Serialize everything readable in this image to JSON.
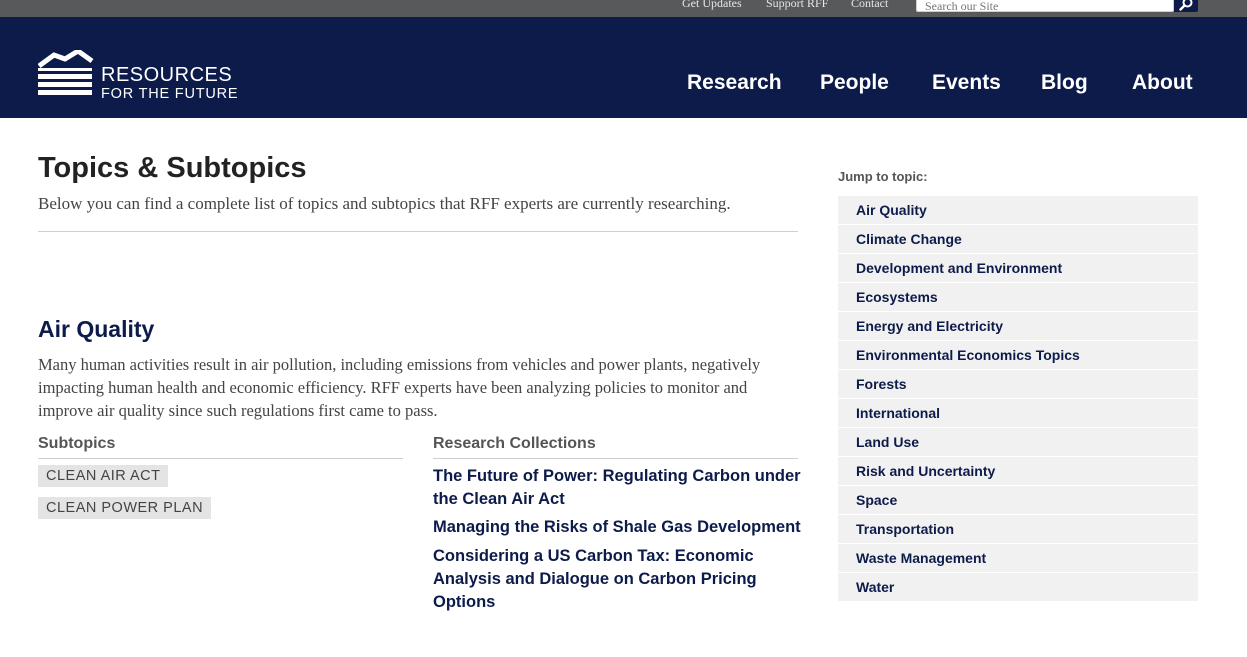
{
  "utility_bar": {
    "links": [
      "Get Updates",
      "Support RFF",
      "Contact"
    ],
    "search_placeholder": "Search our Site"
  },
  "header": {
    "logo_line1": "RESOURCES",
    "logo_line2": "FOR THE FUTURE",
    "nav": [
      "Research",
      "People",
      "Events",
      "Blog",
      "About"
    ]
  },
  "main": {
    "title": "Topics & Subtopics",
    "intro": "Below you can find a complete list of topics and subtopics that RFF experts are currently researching.",
    "section": {
      "title": "Air Quality",
      "description": "Many human activities result in air pollution, including emissions from vehicles and power plants, negatively impacting human health and economic efficiency. RFF experts have been analyzing policies to monitor and improve air quality since such regulations first came to pass.",
      "subtopics_heading": "Subtopics",
      "subtopics": [
        "CLEAN AIR ACT",
        "CLEAN POWER PLAN"
      ],
      "collections_heading": "Research Collections",
      "collections": [
        "The Future of Power: Regulating Carbon under the Clean Air Act",
        "Managing the Risks of Shale Gas Development",
        "Considering a US Carbon Tax: Economic Analysis and Dialogue on Carbon Pricing Options"
      ]
    }
  },
  "sidebar": {
    "label": "Jump to topic:",
    "topics": [
      "Air Quality",
      "Climate Change",
      "Development and Environment",
      "Ecosystems",
      "Energy and Electricity",
      "Environmental Economics Topics",
      "Forests",
      "International",
      "Land Use",
      "Risk and Uncertainty",
      "Space",
      "Transportation",
      "Waste Management",
      "Water"
    ]
  },
  "colors": {
    "navy": "#0d1b4a",
    "utility_gray": "#58595b",
    "tag_bg": "#e4e4e4",
    "sidebar_bg": "#f1f1f1"
  },
  "icons": [
    "search-icon",
    "rff-logo-icon"
  ]
}
